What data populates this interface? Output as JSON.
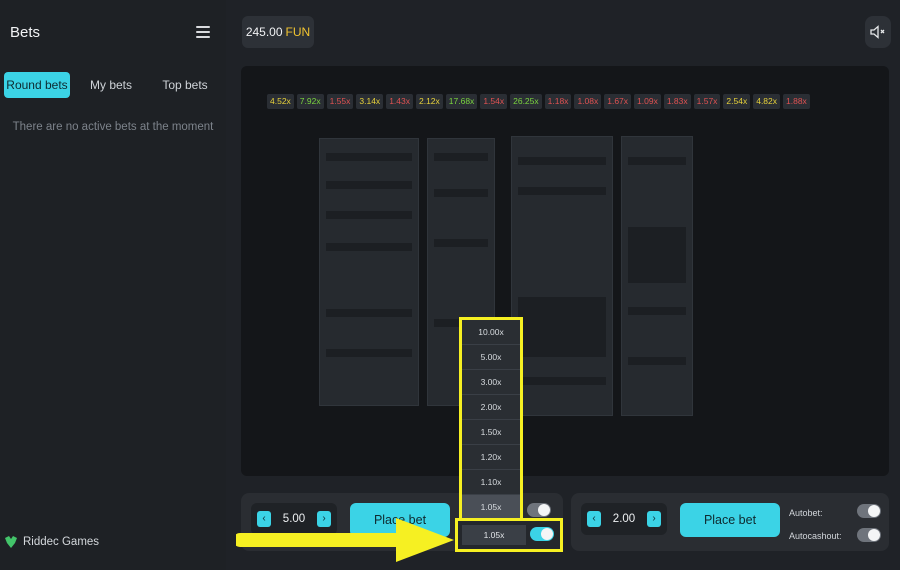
{
  "sidebar": {
    "title": "Bets",
    "tabs": [
      "Round bets",
      "My bets",
      "Top bets"
    ],
    "empty_message": "There are no active bets at the moment",
    "brand": "Riddec Games"
  },
  "header": {
    "balance_amount": "245.00",
    "balance_currency": "FUN"
  },
  "history": [
    {
      "v": "4.52x",
      "c": "#e8d23a"
    },
    {
      "v": "7.92x",
      "c": "#7ad43f"
    },
    {
      "v": "1.55x",
      "c": "#e05252"
    },
    {
      "v": "3.14x",
      "c": "#e8d23a"
    },
    {
      "v": "1.43x",
      "c": "#e05252"
    },
    {
      "v": "2.12x",
      "c": "#e8d23a"
    },
    {
      "v": "17.68x",
      "c": "#7ad43f"
    },
    {
      "v": "1.54x",
      "c": "#e05252"
    },
    {
      "v": "26.25x",
      "c": "#7ad43f"
    },
    {
      "v": "1.18x",
      "c": "#e05252"
    },
    {
      "v": "1.08x",
      "c": "#e05252"
    },
    {
      "v": "1.67x",
      "c": "#e05252"
    },
    {
      "v": "1.09x",
      "c": "#e05252"
    },
    {
      "v": "1.83x",
      "c": "#e05252"
    },
    {
      "v": "1.57x",
      "c": "#e05252"
    },
    {
      "v": "2.54x",
      "c": "#e8d23a"
    },
    {
      "v": "4.82x",
      "c": "#e8d23a"
    },
    {
      "v": "1.88x",
      "c": "#e05252"
    }
  ],
  "panel_left": {
    "amount": "5.00",
    "place_label": "Place bet"
  },
  "panel_right": {
    "amount": "2.00",
    "place_label": "Place bet",
    "autobet_label": "Autobet:",
    "autocashout_label": "Autocashout:"
  },
  "dropdown": {
    "options": [
      "10.00x",
      "5.00x",
      "3.00x",
      "2.00x",
      "1.50x",
      "1.20x",
      "1.10x",
      "1.05x"
    ],
    "selected": "1.05x"
  },
  "colors": {
    "accent": "#3bd3e6",
    "highlight": "#f6f022",
    "currency": "#f3c530"
  }
}
